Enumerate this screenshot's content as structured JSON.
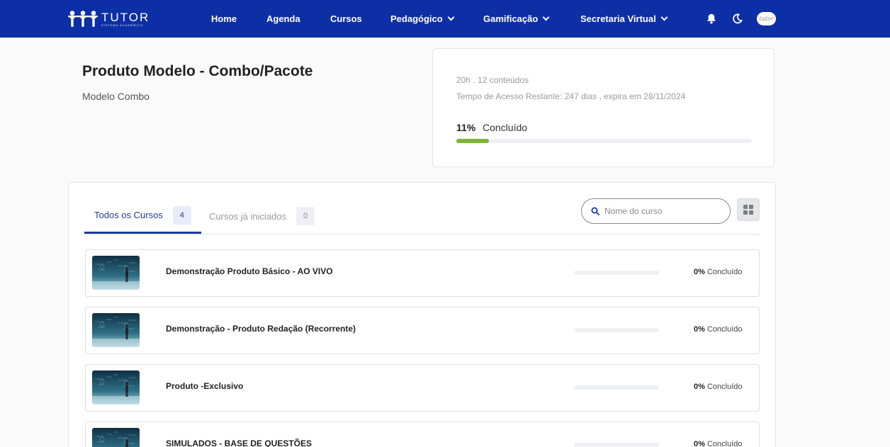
{
  "colors": {
    "brand": "#0d2fa6",
    "progress": "#7cb53a",
    "active_tab": "#1b3c9e"
  },
  "nav": {
    "logo_title": "TUTOR",
    "logo_subtitle": "SISTEMA ACADÊMICO",
    "items": [
      {
        "label": "Home",
        "has_dropdown": false
      },
      {
        "label": "Agenda",
        "has_dropdown": false
      },
      {
        "label": "Cursos",
        "has_dropdown": false
      },
      {
        "label": "Pedagógico",
        "has_dropdown": true
      },
      {
        "label": "Gamificação",
        "has_dropdown": true
      },
      {
        "label": "Secretaria Virtual",
        "has_dropdown": true
      }
    ],
    "icons": [
      "bell-icon",
      "moon-icon"
    ],
    "avatar_text": "tutor"
  },
  "header": {
    "title": "Produto Modelo - Combo/Pacote",
    "subtitle": "Modelo Combo"
  },
  "progress_card": {
    "summary": "20h . 12 conteúdos",
    "access": "Tempo de Acesso Restante: 247 dias , expira em 28/11/2024",
    "percent_text": "11%",
    "percent_value": 11,
    "label": "Concluído"
  },
  "tabs": [
    {
      "label": "Todos os Cursos",
      "count": "4",
      "active": true
    },
    {
      "label": "Cursos já iniciados",
      "count": "0",
      "active": false
    }
  ],
  "search": {
    "placeholder": "Nome do curso",
    "value": ""
  },
  "grid_toggle_icon": "grid-icon",
  "courses": [
    {
      "title": "Demonstração Produto Básico - AO VIVO",
      "percent_text": "0%",
      "percent_value": 0,
      "done_label": "Concluído"
    },
    {
      "title": "Demonstração - Produto Redação (Recorrente)",
      "percent_text": "0%",
      "percent_value": 0,
      "done_label": "Concluído"
    },
    {
      "title": "Produto -Exclusivo",
      "percent_text": "0%",
      "percent_value": 0,
      "done_label": "Concluído"
    },
    {
      "title": "SIMULADOS - BASE DE QUESTÕES",
      "percent_text": "0%",
      "percent_value": 0,
      "done_label": "Concluído"
    }
  ]
}
